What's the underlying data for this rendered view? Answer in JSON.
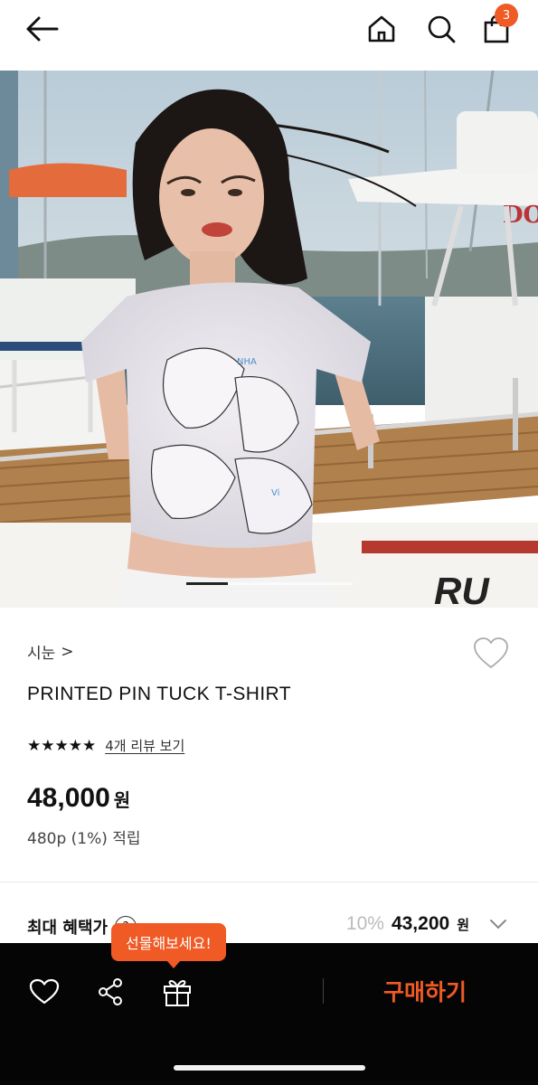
{
  "header": {
    "back_icon": "arrow-left-icon",
    "home_icon": "home-icon",
    "search_icon": "search-icon",
    "bag_icon": "shopping-bag-icon",
    "bag_count": "3"
  },
  "hero": {
    "image": "product photo: model wearing printed t-shirt at marina",
    "pager_current": 1,
    "pager_total": 4
  },
  "product": {
    "brand": "시눈",
    "brand_chevron": ">",
    "title": "PRINTED PIN TUCK T-SHIRT",
    "stars": "★★★★★",
    "rating_value": 5,
    "review_link": "4개 리뷰 보기",
    "price": "48,000",
    "price_unit": "원",
    "points": "480p (1%) 적립"
  },
  "benefit": {
    "label": "최대 혜택가",
    "help": "?",
    "discount": "10%",
    "discount_price": "43,200",
    "discount_unit": "원"
  },
  "bottombar": {
    "tooltip": "선물해보세요!",
    "buy_label": "구매하기"
  },
  "colors": {
    "accent": "#ef5a25",
    "bottombar_bg": "#050505"
  }
}
